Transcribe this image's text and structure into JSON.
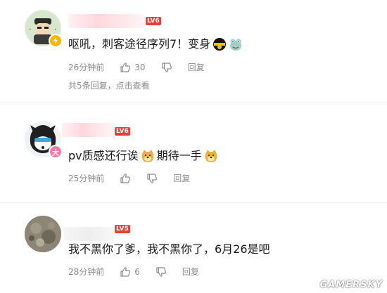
{
  "comments": [
    {
      "level": "LV6",
      "text": "呕吼，刺客途径序列7！变身",
      "time": "26分钟前",
      "likes": "30",
      "reply_label": "回复",
      "reply_summary": "共5条回复，点击查看",
      "badge_color": "#f5b800",
      "badge_icon": "lightning-icon"
    },
    {
      "level": "LV6",
      "text_part1": "pv质感还行诶",
      "text_part2": "期待一手",
      "time": "25分钟前",
      "reply_label": "回复",
      "badge_color": "#f77aa6",
      "badge_label": "大"
    },
    {
      "level": "LV5",
      "text": "我不黑你了爹，我不黑你了，6月26是吧",
      "time": "28分钟前",
      "likes": "6",
      "reply_label": "回复"
    }
  ],
  "watermark": "GAMERSKY"
}
